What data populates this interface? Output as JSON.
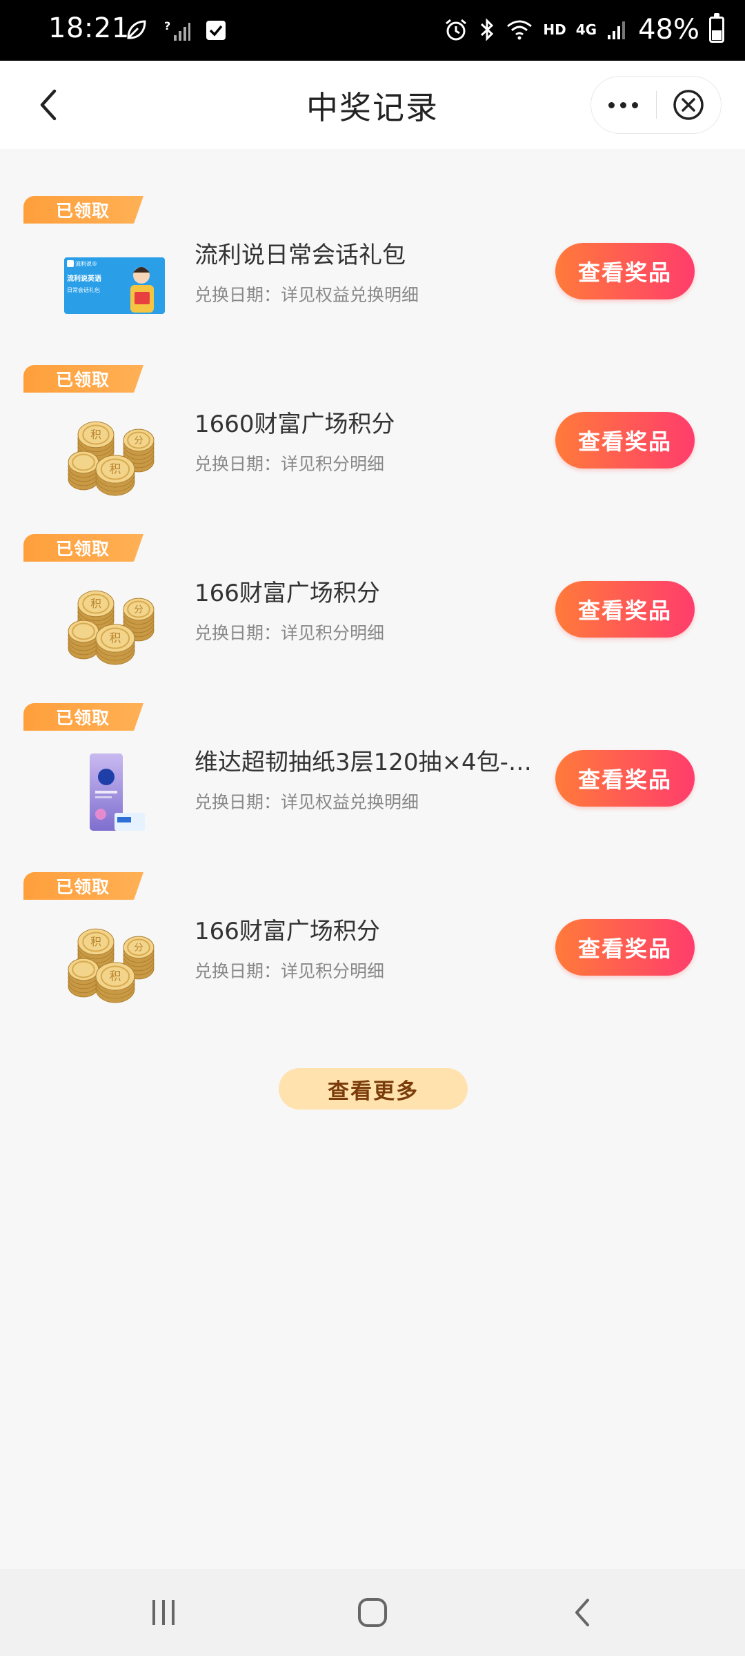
{
  "status_bar": {
    "time": "18:21",
    "network_hd": "HD",
    "network_4g": "4G",
    "battery_percent": "48%",
    "left_icons": [
      "leaf-icon",
      "signal-unknown-icon",
      "checkbox-icon"
    ],
    "right_icons": [
      "alarm-icon",
      "bluetooth-icon",
      "wifi-icon",
      "cell-signal-icon",
      "battery-icon"
    ]
  },
  "header": {
    "title": "中奖记录",
    "back_icon": "chevron-left-icon",
    "more_icon": "more-dots-icon",
    "close_icon": "close-circle-icon"
  },
  "records": [
    {
      "status": "已领取",
      "name": "流利说日常会话礼包",
      "date": "兑换日期：详见权益兑换明细",
      "button": "查看奖品",
      "thumb": "gift-card-image",
      "thumb_card_brand": "流利说®",
      "thumb_card_title": "流利说英语",
      "thumb_card_sub": "日常会话礼包"
    },
    {
      "status": "已领取",
      "name": "1660财富广场积分",
      "date": "兑换日期：详见积分明细",
      "button": "查看奖品",
      "thumb": "coins-image"
    },
    {
      "status": "已领取",
      "name": "166财富广场积分",
      "date": "兑换日期：详见积分明细",
      "button": "查看奖品",
      "thumb": "coins-image"
    },
    {
      "status": "已领取",
      "name": "维达超韧抽纸3层120抽×4包-券后...",
      "date": "兑换日期：详见权益兑换明细",
      "button": "查看奖品",
      "thumb": "tissue-pack-image"
    },
    {
      "status": "已领取",
      "name": "166财富广场积分",
      "date": "兑换日期：详见积分明细",
      "button": "查看奖品",
      "thumb": "coins-image"
    }
  ],
  "view_more": "查看更多",
  "coin_glyphs": [
    "积",
    "分",
    "积"
  ],
  "colors": {
    "accent_gradient_start": "#ff7a3a",
    "accent_gradient_end": "#ff3d6c",
    "tag_orange": "#ff9f3c",
    "view_more_bg": "#ffe2ae"
  },
  "system_nav": [
    "recent-apps-icon",
    "home-icon",
    "back-icon"
  ]
}
